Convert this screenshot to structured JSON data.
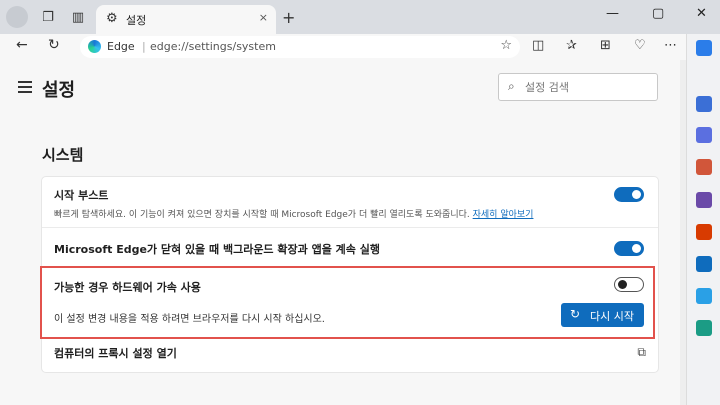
{
  "tab": {
    "title": "설정",
    "close": "×"
  },
  "new_tab": "+",
  "window_controls": {
    "minimize": "—",
    "maximize": "▢",
    "close": "✕"
  },
  "address": {
    "browser_label": "Edge",
    "separator": "|",
    "url": "edge://settings/system"
  },
  "page": {
    "title": "설정",
    "section_title": "시스템"
  },
  "search": {
    "placeholder": "설정 검색"
  },
  "settings": {
    "startup_boost": {
      "title": "시작 부스트",
      "description": "빠르게 탐색하세요. 이 기능이 켜져 있으면 장치를 시작할 때 Microsoft Edge가 더 빨리 열리도록 도와줍니다.",
      "link": "자세히 알아보기",
      "enabled": true
    },
    "background": {
      "title": "Microsoft Edge가 닫혀 있을 때 백그라운드 확장과 앱을 계속 실행",
      "enabled": true
    },
    "hardware_acceleration": {
      "title": "가능한 경우 하드웨어 가속 사용",
      "notice": "이 설정 변경 내용을 적용 하려면 브라우저를 다시 시작 하십시오.",
      "restart_label": "다시 시작",
      "enabled": false
    },
    "proxy": {
      "title": "컴퓨터의 프록시 설정 열기"
    }
  },
  "colors": {
    "accent": "#0f6cbd",
    "highlight": "#e2524c"
  },
  "icons": {
    "tab_gear": "⚙",
    "search": "⌕",
    "restart": "↻",
    "external": "⧉",
    "back": "←",
    "refresh": "↻",
    "star": "☆"
  },
  "sidebar_icons": [
    {
      "name": "copilot-icon",
      "color": "#2b7de9"
    },
    {
      "name": "search-icon",
      "color": "#3b6fd6"
    },
    {
      "name": "shopping-icon",
      "color": "#5b6fe0"
    },
    {
      "name": "tools-icon",
      "color": "#d1563a"
    },
    {
      "name": "games-icon",
      "color": "#6b4aa8"
    },
    {
      "name": "office-icon",
      "color": "#d83b01"
    },
    {
      "name": "outlook-icon",
      "color": "#0f6cbd"
    },
    {
      "name": "drop-icon",
      "color": "#2aa0e6"
    },
    {
      "name": "designer-icon",
      "color": "#1b9c85"
    }
  ]
}
